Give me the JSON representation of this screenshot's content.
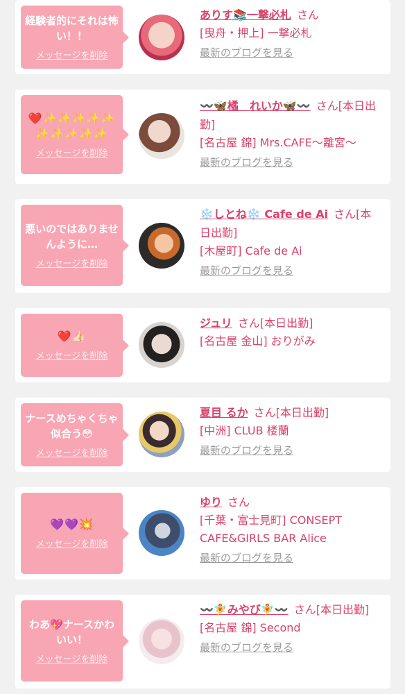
{
  "app": {
    "delete_label": "メッセージを削除",
    "blog_label": "最新のブログを見る",
    "san": "さん",
    "accent_color": "#d9426b",
    "bubble_color": "#f8a5b4"
  },
  "messages": [
    {
      "message": "経験者的にそれは怖い！！",
      "name": "ありす📚一撃必札",
      "status": "",
      "shop": "[曳舟・押上] 一撃必札"
    },
    {
      "message": "❤️✨✨✨✨✨✨✨✨✨✨",
      "name": "〰️🦋橘　れいか🦋〰️",
      "status": "[本日出勤]",
      "shop": "[名古屋 錦] Mrs.CAFE〜離宮〜"
    },
    {
      "message": "悪いのではありませんように…",
      "name": "❄️しとね❄️ Cafe de Ai",
      "status": "[本日出勤]",
      "shop": "[木屋町] Cafe de Ai"
    },
    {
      "message": "❤️👍🏻",
      "name": "ジュリ",
      "status": "[本日出勤]",
      "shop": "[名古屋 金山] おりがみ"
    },
    {
      "message": "ナースめちゃくちゃ似合う😳",
      "name": "夏目 るか",
      "status": "[本日出勤]",
      "shop": "[中洲] CLUB 楼蘭"
    },
    {
      "message": "💜💜💥",
      "name": "ゆり",
      "status": "",
      "shop": "[千葉・富士見町] CONSEPT CAFE&GIRLS BAR Alice"
    },
    {
      "message": "わあ💖ナースかわいい！",
      "name": "〰️🧚みやび🧚〰️",
      "status": "[本日出勤]",
      "shop": "[名古屋 錦] Second"
    }
  ]
}
